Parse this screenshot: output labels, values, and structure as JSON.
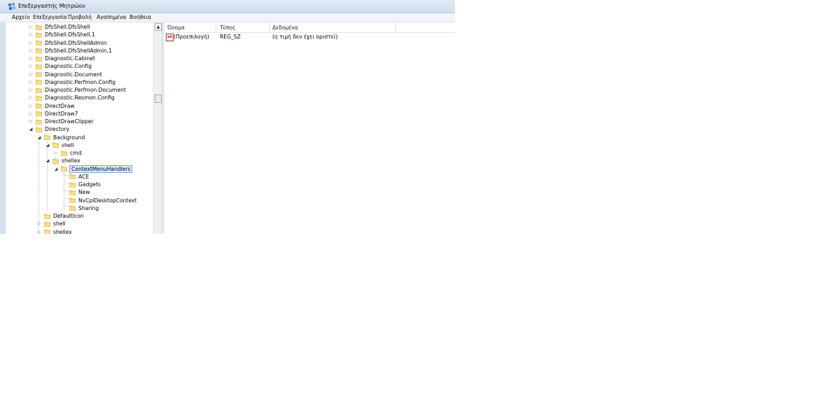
{
  "window": {
    "title": "Επεξεργαστής Μητρώου"
  },
  "menu": [
    {
      "label": "Αρχείο"
    },
    {
      "label": "Επεξεργασία"
    },
    {
      "label": "Προβολή"
    },
    {
      "label": "Αγαπημένα"
    },
    {
      "label": "Βοήθεια"
    }
  ],
  "tree": {
    "items": [
      {
        "label": "DfsShell.DfsShell",
        "expander": "closed",
        "level": 0
      },
      {
        "label": "DfsShell.DfsShell.1",
        "expander": "closed",
        "level": 0
      },
      {
        "label": "DfsShell.DfsShellAdmin",
        "expander": "closed",
        "level": 0
      },
      {
        "label": "DfsShell.DfsShellAdmin.1",
        "expander": "closed",
        "level": 0
      },
      {
        "label": "Diagnostic.Cabinet",
        "expander": "closed",
        "level": 0
      },
      {
        "label": "Diagnostic.Config",
        "expander": "closed",
        "level": 0
      },
      {
        "label": "Diagnostic.Document",
        "expander": "closed",
        "level": 0
      },
      {
        "label": "Diagnostic.Perfmon.Config",
        "expander": "closed",
        "level": 0
      },
      {
        "label": "Diagnostic.Perfmon.Document",
        "expander": "closed",
        "level": 0
      },
      {
        "label": "Diagnostic.Resmon.Config",
        "expander": "closed",
        "level": 0
      },
      {
        "label": "DirectDraw",
        "expander": "closed",
        "level": 0
      },
      {
        "label": "DirectDraw7",
        "expander": "closed",
        "level": 0
      },
      {
        "label": "DirectDrawClipper",
        "expander": "closed",
        "level": 0
      },
      {
        "label": "Directory",
        "expander": "open",
        "level": 0
      },
      {
        "label": "Background",
        "expander": "open",
        "level": 1
      },
      {
        "label": "shell",
        "expander": "open",
        "level": 2
      },
      {
        "label": "cmd",
        "expander": "closed",
        "level": 3
      },
      {
        "label": "shellex",
        "expander": "open",
        "level": 2
      },
      {
        "label": "ContextMenuHandlers",
        "expander": "open",
        "level": 3,
        "selected": true
      },
      {
        "label": "ACE",
        "expander": "none",
        "level": 4
      },
      {
        "label": "Gadgets",
        "expander": "none",
        "level": 4
      },
      {
        "label": "New",
        "expander": "none",
        "level": 4
      },
      {
        "label": "NvCplDesktopContext",
        "expander": "none",
        "level": 4
      },
      {
        "label": "Sharing",
        "expander": "none",
        "level": 4
      },
      {
        "label": "DefaultIcon",
        "expander": "none",
        "level": 1
      },
      {
        "label": "shell",
        "expander": "closed",
        "level": 1
      },
      {
        "label": "shellex",
        "expander": "closed",
        "level": 1
      }
    ]
  },
  "list": {
    "columns": [
      "Όνομα",
      "Τύπος",
      "Δεδομένα"
    ],
    "rows": [
      {
        "name": "(Προεπιλογή)",
        "type": "REG_SZ",
        "data": "(η τιμή δεν έχει οριστεί)"
      }
    ]
  },
  "icons": {
    "app": "registry-editor-icon",
    "folder": "folder-icon",
    "string_value": "reg-string-icon"
  },
  "colors": {
    "selection_bg": "#dbe9fb",
    "selection_border": "#7da2ce",
    "folder_yellow": "#f5d36a"
  }
}
